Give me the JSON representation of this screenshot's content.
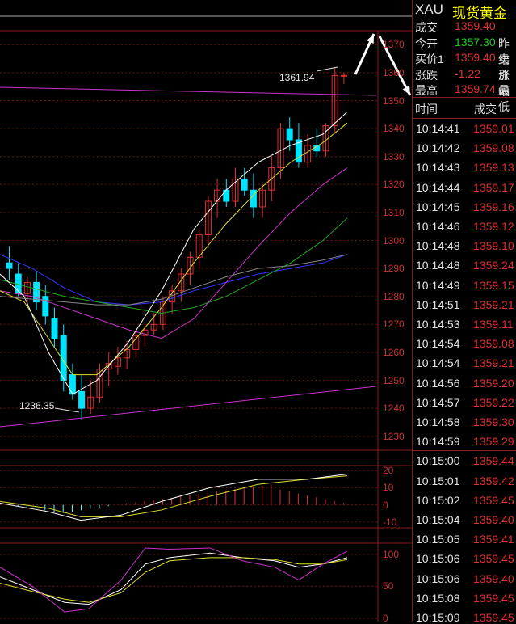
{
  "symbol": "XAU",
  "name": "现货黄金",
  "quote": [
    {
      "label": "成交",
      "value": "1359.40",
      "color": "#e03030",
      "side": ""
    },
    {
      "label": "今开",
      "value": "1357.30",
      "color": "#22cc22",
      "side": "昨结"
    },
    {
      "label": "买价1",
      "value": "1359.40",
      "color": "#e03030",
      "side": "卖价"
    },
    {
      "label": "涨跌",
      "value": "-1.22",
      "color": "#e03030",
      "side": "涨幅"
    },
    {
      "label": "最高",
      "value": "1359.74",
      "color": "#e03030",
      "side": "最低"
    }
  ],
  "ticks_header": {
    "time": "时间",
    "price": "成交"
  },
  "ticks": [
    {
      "time": "10:14:41",
      "price": "1359.01"
    },
    {
      "time": "10:14:42",
      "price": "1359.08"
    },
    {
      "time": "10:14:43",
      "price": "1359.13"
    },
    {
      "time": "10:14:44",
      "price": "1359.17"
    },
    {
      "time": "10:14:45",
      "price": "1359.16"
    },
    {
      "time": "10:14:46",
      "price": "1359.12"
    },
    {
      "time": "10:14:48",
      "price": "1359.10"
    },
    {
      "time": "10:14:48",
      "price": "1359.24"
    },
    {
      "time": "10:14:49",
      "price": "1359.15"
    },
    {
      "time": "10:14:51",
      "price": "1359.21"
    },
    {
      "time": "10:14:53",
      "price": "1359.11"
    },
    {
      "time": "10:14:54",
      "price": "1359.08"
    },
    {
      "time": "10:14:54",
      "price": "1359.21"
    },
    {
      "time": "10:14:56",
      "price": "1359.20"
    },
    {
      "time": "10:14:57",
      "price": "1359.22"
    },
    {
      "time": "10:14:58",
      "price": "1359.30"
    },
    {
      "time": "10:14:59",
      "price": "1359.29"
    },
    {
      "time": "10:15:00",
      "price": "1359.44"
    },
    {
      "time": "10:15:01",
      "price": "1359.42"
    },
    {
      "time": "10:15:02",
      "price": "1359.45"
    },
    {
      "time": "10:15:04",
      "price": "1359.40"
    },
    {
      "time": "10:15:05",
      "price": "1359.41"
    },
    {
      "time": "10:15:06",
      "price": "1359.45"
    },
    {
      "time": "10:15:06",
      "price": "1359.40"
    },
    {
      "time": "10:15:08",
      "price": "1359.45"
    },
    {
      "time": "10:15:09",
      "price": "1359.45"
    }
  ],
  "annotations": {
    "high": "1361.94",
    "low": "1236.35"
  },
  "chart_data": {
    "type": "candlestick",
    "main_axis": {
      "ylim": [
        1225,
        1375
      ],
      "ticks": [
        "1370",
        "1360",
        "1350",
        "1340",
        "1330",
        "1320",
        "1310",
        "1300",
        "1290",
        "1280",
        "1270",
        "1260",
        "1250",
        "1240",
        "1230"
      ]
    },
    "macd_axis": {
      "ylim": [
        -12,
        22
      ],
      "ticks": [
        "20",
        "10",
        "0",
        "-10"
      ]
    },
    "kdj_axis": {
      "ylim": [
        0,
        115
      ],
      "ticks": [
        "100",
        "50",
        "0"
      ]
    },
    "up_color": "#e03030",
    "down_color": "#00e5ff"
  }
}
